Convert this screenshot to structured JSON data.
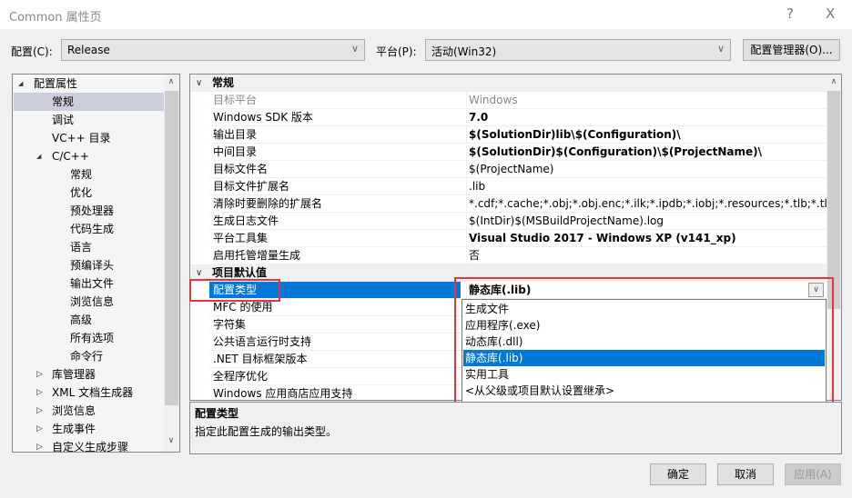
{
  "window": {
    "title": "Common 属性页",
    "help": "?",
    "close": "X"
  },
  "toolbar": {
    "config_label": "配置(C):",
    "config_value": "Release",
    "platform_label": "平台(P):",
    "platform_value": "活动(Win32)",
    "config_manager": "配置管理器(O)..."
  },
  "tree": [
    {
      "label": "配置属性",
      "level": 0,
      "state": "expanded"
    },
    {
      "label": "常规",
      "level": 1,
      "selected": true
    },
    {
      "label": "调试",
      "level": 1
    },
    {
      "label": "VC++ 目录",
      "level": 1
    },
    {
      "label": "C/C++",
      "level": 1,
      "state": "expanded"
    },
    {
      "label": "常规",
      "level": 2
    },
    {
      "label": "优化",
      "level": 2
    },
    {
      "label": "预处理器",
      "level": 2
    },
    {
      "label": "代码生成",
      "level": 2
    },
    {
      "label": "语言",
      "level": 2
    },
    {
      "label": "预编译头",
      "level": 2
    },
    {
      "label": "输出文件",
      "level": 2
    },
    {
      "label": "浏览信息",
      "level": 2
    },
    {
      "label": "高级",
      "level": 2
    },
    {
      "label": "所有选项",
      "level": 2
    },
    {
      "label": "命令行",
      "level": 2
    },
    {
      "label": "库管理器",
      "level": 1,
      "state": "collapsed"
    },
    {
      "label": "XML 文档生成器",
      "level": 1,
      "state": "collapsed"
    },
    {
      "label": "浏览信息",
      "level": 1,
      "state": "collapsed"
    },
    {
      "label": "生成事件",
      "level": 1,
      "state": "collapsed"
    },
    {
      "label": "自定义生成步骤",
      "level": 1,
      "state": "collapsed"
    }
  ],
  "grid": {
    "sections": [
      {
        "title": "常规",
        "rows": [
          {
            "name": "目标平台",
            "value": "Windows",
            "style": "gray"
          },
          {
            "name": "Windows SDK 版本",
            "value": "7.0",
            "style": "b"
          },
          {
            "name": "输出目录",
            "value": "$(SolutionDir)lib\\$(Configuration)\\",
            "style": "b"
          },
          {
            "name": "中间目录",
            "value": "$(SolutionDir)$(Configuration)\\$(ProjectName)\\",
            "style": "b"
          },
          {
            "name": "目标文件名",
            "value": "$(ProjectName)",
            "style": ""
          },
          {
            "name": "目标文件扩展名",
            "value": ".lib",
            "style": ""
          },
          {
            "name": "清除时要删除的扩展名",
            "value": "*.cdf;*.cache;*.obj;*.obj.enc;*.ilk;*.ipdb;*.iobj;*.resources;*.tlb;*.tli;*.tlh;*",
            "style": ""
          },
          {
            "name": "生成日志文件",
            "value": "$(IntDir)$(MSBuildProjectName).log",
            "style": ""
          },
          {
            "name": "平台工具集",
            "value": "Visual Studio 2017 - Windows XP (v141_xp)",
            "style": "b"
          },
          {
            "name": "启用托管增量生成",
            "value": "否",
            "style": ""
          }
        ]
      },
      {
        "title": "项目默认值",
        "rows": [
          {
            "name": "配置类型",
            "value": "静态库(.lib)",
            "style": "b sel"
          },
          {
            "name": "MFC 的使用",
            "value": "",
            "style": ""
          },
          {
            "name": "字符集",
            "value": "",
            "style": ""
          },
          {
            "name": "公共语言运行时支持",
            "value": "",
            "style": ""
          },
          {
            "name": ".NET 目标框架版本",
            "value": "",
            "style": ""
          },
          {
            "name": "全程序优化",
            "value": "",
            "style": ""
          },
          {
            "name": "Windows 应用商店应用支持",
            "value": "",
            "style": ""
          }
        ]
      }
    ]
  },
  "dropdown": {
    "options": [
      "生成文件",
      "应用程序(.exe)",
      "动态库(.dll)",
      "静态库(.lib)",
      "实用工具",
      "<从父级或项目默认设置继承>"
    ],
    "selected_index": 3
  },
  "description": {
    "title": "配置类型",
    "text": "指定此配置生成的输出类型。"
  },
  "buttons": {
    "ok": "确定",
    "cancel": "取消",
    "apply": "应用(A)"
  },
  "colors": {
    "accent": "#0078d7",
    "highlight_box": "#e8323c",
    "tree_selection": "#cccedb"
  }
}
